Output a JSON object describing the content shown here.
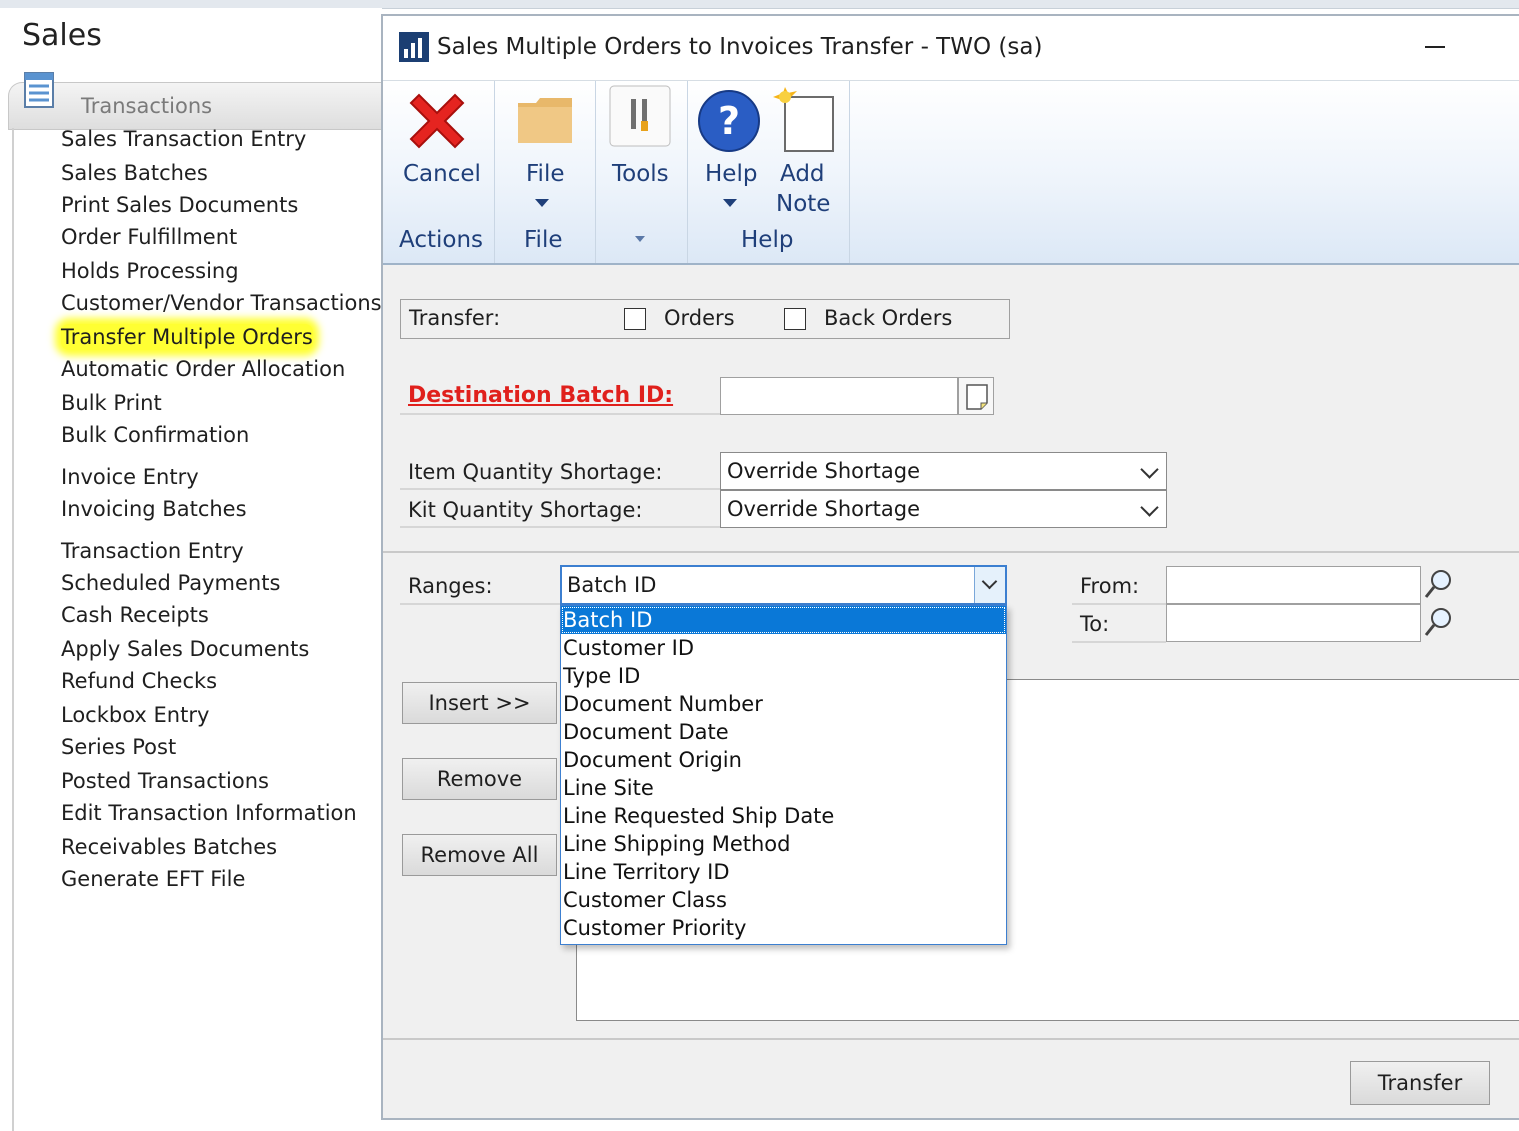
{
  "left_pane": {
    "title": "Sales",
    "section_label": "Transactions",
    "items": [
      {
        "label": "Sales Transaction Entry"
      },
      {
        "label": "Sales Batches"
      },
      {
        "label": "Print Sales Documents"
      },
      {
        "label": "Order Fulfillment"
      },
      {
        "label": "Holds Processing"
      },
      {
        "label": "Customer/Vendor Transactions"
      },
      {
        "label": "Transfer Multiple Orders",
        "highlighted": true
      },
      {
        "label": "Automatic Order Allocation"
      },
      {
        "label": "Bulk Print"
      },
      {
        "label": "Bulk Confirmation"
      },
      {
        "label": "Invoice Entry"
      },
      {
        "label": "Invoicing Batches"
      },
      {
        "label": "Transaction Entry"
      },
      {
        "label": "Scheduled Payments"
      },
      {
        "label": "Cash Receipts"
      },
      {
        "label": "Apply Sales Documents"
      },
      {
        "label": "Refund Checks"
      },
      {
        "label": "Lockbox Entry"
      },
      {
        "label": "Series Post"
      },
      {
        "label": "Posted Transactions"
      },
      {
        "label": "Edit Transaction Information"
      },
      {
        "label": "Receivables Batches"
      },
      {
        "label": "Generate EFT File"
      }
    ],
    "highlight_color": "#ffff33"
  },
  "window": {
    "title": "Sales Multiple Orders to Invoices Transfer  -  TWO (sa)"
  },
  "ribbon": {
    "cancel_label": "Cancel",
    "file_label": "File",
    "tools_label": "Tools",
    "help_label": "Help",
    "add_note_line1": "Add",
    "add_note_line2": "Note",
    "group_actions": "Actions",
    "group_file": "File",
    "group_help": "Help"
  },
  "form": {
    "transfer_label": "Transfer:",
    "orders_label": "Orders",
    "back_orders_label": "Back Orders",
    "orders_checked": false,
    "back_orders_checked": false,
    "destination_batch_label": "Destination Batch ID:",
    "destination_batch_value": "",
    "item_qty_label": "Item Quantity Shortage:",
    "item_qty_value": "Override Shortage",
    "kit_qty_label": "Kit Quantity Shortage:",
    "kit_qty_value": "Override Shortage",
    "ranges_label": "Ranges:",
    "ranges_value": "Batch ID",
    "from_label": "From:",
    "to_label": "To:",
    "from_value": "",
    "to_value": "",
    "insert_label": "Insert >>",
    "remove_label": "Remove",
    "remove_all_label": "Remove All",
    "transfer_button_label": "Transfer",
    "required_color": "#e0201c"
  },
  "ranges_dropdown": {
    "options": [
      {
        "label": "Batch ID",
        "selected": true
      },
      {
        "label": "Customer ID"
      },
      {
        "label": "Type ID"
      },
      {
        "label": "Document Number"
      },
      {
        "label": "Document Date"
      },
      {
        "label": "Document Origin"
      },
      {
        "label": "Line Site"
      },
      {
        "label": "Line Requested Ship Date"
      },
      {
        "label": "Line Shipping Method"
      },
      {
        "label": "Line Territory ID"
      },
      {
        "label": "Customer Class"
      },
      {
        "label": "Customer Priority"
      }
    ],
    "selection_color": "#0a78d7"
  }
}
